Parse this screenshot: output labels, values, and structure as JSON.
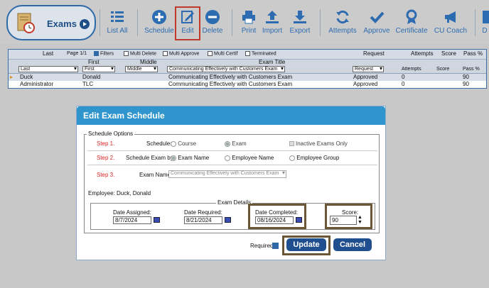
{
  "module": {
    "title": "Exams"
  },
  "toolbar": {
    "list_all": "List All",
    "schedule": "Schedule",
    "edit": "Edit",
    "delete": "Delete",
    "print": "Print",
    "import": "Import",
    "export": "Export",
    "attempts": "Attempts",
    "approve": "Approve",
    "certificate": "Certificate",
    "cu_coach": "CU Coach",
    "more": "D"
  },
  "grid": {
    "headers": {
      "last": "Last",
      "first": "First",
      "middle": "Middle",
      "exam_title": "Exam Title",
      "request": "Request",
      "attempts": "Attempts",
      "score": "Score",
      "pass": "Pass %"
    },
    "page": "Page 1/1",
    "options": {
      "filters": "Filters",
      "multi_delete": "Multi Delete",
      "multi_approve": "Multi Approve",
      "multi_certif": "Multi Certif",
      "terminated": "Terminated"
    },
    "filters": {
      "last": "Last",
      "first": "First",
      "middle": "Middle",
      "exam_title": "Communicating Effectively with Customers Exam",
      "request": "Request",
      "attempts": "Attempts",
      "score": "Score",
      "pass": "Pass %"
    },
    "rows": [
      {
        "last": "Duck",
        "first": "Donald",
        "exam": "Communicating Effectively with Customers Exam",
        "request": "Approved",
        "attempts": "0",
        "pass": "90"
      },
      {
        "last": "Administrator",
        "first": "TLC",
        "exam": "Communicating Effectively with Customers Exam",
        "request": "Approved",
        "attempts": "0",
        "pass": "90"
      }
    ]
  },
  "dialog": {
    "title": "Edit Exam Schedule",
    "schedule_options": "Schedule Options",
    "step1": "Step 1.",
    "schedule_label": "Schedule:",
    "course": "Course",
    "exam": "Exam",
    "inactive": "Inactive Exams Only",
    "step2": "Step 2.",
    "schedule_by_label": "Schedule Exam by:",
    "by_name": "Exam Name",
    "by_employee": "Employee Name",
    "by_group": "Employee Group",
    "step3": "Step 3.",
    "exam_name_label": "Exam Name:",
    "exam_name_value": "Communicating Effectively with Customers Exam",
    "employee": "Employee: Duck, Donald",
    "exam_details": "Exam Details",
    "date_assigned_label": "Date Assigned:",
    "date_assigned": "8/7/2024",
    "date_required_label": "Date Required:",
    "date_required": "8/21/2024",
    "date_completed_label": "Date Completed:",
    "date_completed": "08/16/2024",
    "score_label": "Score:",
    "score": "90",
    "required_label": "Required:",
    "update": "Update",
    "cancel": "Cancel"
  },
  "colors": {
    "accent": "#2f69a8",
    "title_bar": "#2f95cc",
    "highlight": "#6b5635",
    "edit_highlight": "#c0392b"
  }
}
